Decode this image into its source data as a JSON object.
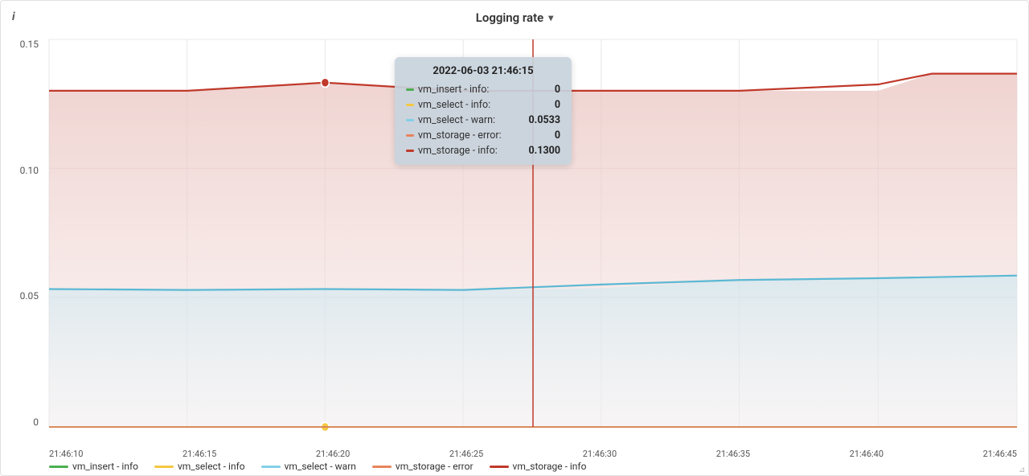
{
  "title": "Logging rate",
  "info_icon": "i",
  "y_axis": {
    "labels": [
      "0.15",
      "0.10",
      "0.05",
      "0"
    ]
  },
  "x_axis": {
    "labels": [
      "21:46:10",
      "21:46:15",
      "21:46:20",
      "21:46:25",
      "21:46:30",
      "21:46:35",
      "21:46:40",
      "21:46:45"
    ]
  },
  "legend": [
    {
      "label": "vm_insert - info",
      "color": "#4caf50"
    },
    {
      "label": "vm_select - info",
      "color": "#f5c842"
    },
    {
      "label": "vm_select - warn",
      "color": "#82cfea"
    },
    {
      "label": "vm_storage - error",
      "color": "#e8845c"
    },
    {
      "label": "vm_storage - info",
      "color": "#c0392b"
    }
  ],
  "tooltip": {
    "timestamp": "2022-06-03 21:46:15",
    "rows": [
      {
        "series": "vm_insert - info:",
        "value": "0",
        "color": "#4caf50"
      },
      {
        "series": "vm_select - info:",
        "value": "0",
        "color": "#f5c842"
      },
      {
        "series": "vm_select - warn:",
        "value": "0.0533",
        "color": "#82cfea"
      },
      {
        "series": "vm_storage - error:",
        "value": "0",
        "color": "#e8845c"
      },
      {
        "series": "vm_storage - info:",
        "value": "0.1300",
        "color": "#c0392b"
      }
    ]
  },
  "dropdown_arrow": "▾"
}
